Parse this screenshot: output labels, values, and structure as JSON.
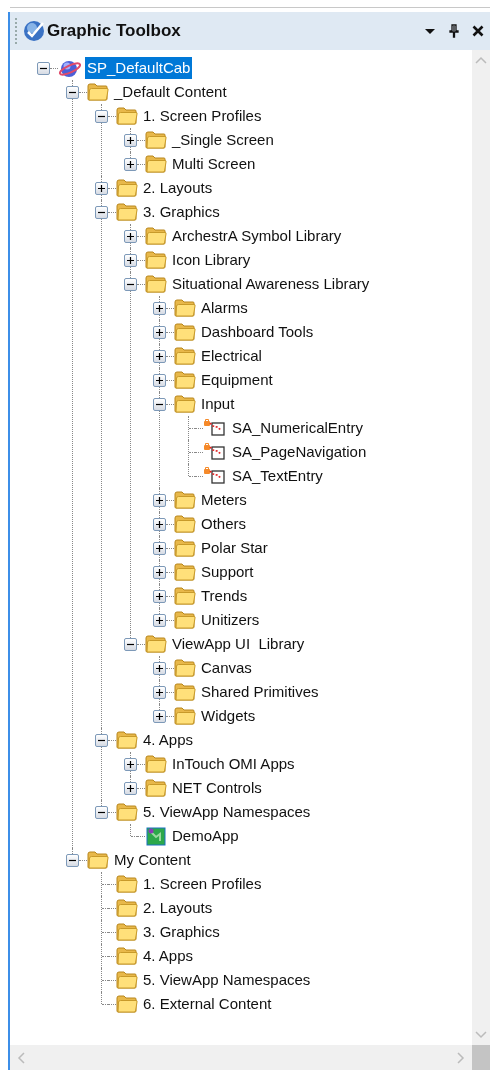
{
  "window": {
    "title": "Graphic Toolbox"
  },
  "tree": [
    {
      "label": "SP_DefaultCab",
      "kind": "root",
      "expanded": true,
      "selected": true,
      "children": [
        {
          "label": "_Default Content",
          "kind": "folder",
          "expanded": true,
          "selected": false,
          "children": [
            {
              "label": "1. Screen Profiles",
              "kind": "folder",
              "expanded": true,
              "selected": false,
              "children": [
                {
                  "label": "_Single Screen",
                  "kind": "folder",
                  "expanded": false,
                  "selected": false
                },
                {
                  "label": "Multi Screen",
                  "kind": "folder",
                  "expanded": false,
                  "selected": false
                }
              ]
            },
            {
              "label": "2. Layouts",
              "kind": "folder",
              "expanded": false,
              "selected": false
            },
            {
              "label": "3. Graphics",
              "kind": "folder",
              "expanded": true,
              "selected": false,
              "children": [
                {
                  "label": "ArchestrA Symbol Library",
                  "kind": "folder",
                  "expanded": false,
                  "selected": false
                },
                {
                  "label": "Icon Library",
                  "kind": "folder",
                  "expanded": false,
                  "selected": false
                },
                {
                  "label": "Situational Awareness Library",
                  "kind": "folder",
                  "expanded": true,
                  "selected": false,
                  "children": [
                    {
                      "label": "Alarms",
                      "kind": "folder",
                      "expanded": false,
                      "selected": false
                    },
                    {
                      "label": "Dashboard Tools",
                      "kind": "folder",
                      "expanded": false,
                      "selected": false
                    },
                    {
                      "label": "Electrical",
                      "kind": "folder",
                      "expanded": false,
                      "selected": false
                    },
                    {
                      "label": "Equipment",
                      "kind": "folder",
                      "expanded": false,
                      "selected": false
                    },
                    {
                      "label": "Input",
                      "kind": "folder",
                      "expanded": true,
                      "selected": false,
                      "children": [
                        {
                          "label": "SA_NumericalEntry",
                          "kind": "symbol",
                          "selected": false
                        },
                        {
                          "label": "SA_PageNavigation",
                          "kind": "symbol",
                          "selected": false
                        },
                        {
                          "label": "SA_TextEntry",
                          "kind": "symbol",
                          "selected": false
                        }
                      ]
                    },
                    {
                      "label": "Meters",
                      "kind": "folder",
                      "expanded": false,
                      "selected": false
                    },
                    {
                      "label": "Others",
                      "kind": "folder",
                      "expanded": false,
                      "selected": false
                    },
                    {
                      "label": "Polar Star",
                      "kind": "folder",
                      "expanded": false,
                      "selected": false
                    },
                    {
                      "label": "Support",
                      "kind": "folder",
                      "expanded": false,
                      "selected": false
                    },
                    {
                      "label": "Trends",
                      "kind": "folder",
                      "expanded": false,
                      "selected": false
                    },
                    {
                      "label": "Unitizers",
                      "kind": "folder",
                      "expanded": false,
                      "selected": false
                    }
                  ]
                },
                {
                  "label": "ViewApp UI  Library",
                  "kind": "folder",
                  "expanded": true,
                  "selected": false,
                  "children": [
                    {
                      "label": "Canvas",
                      "kind": "folder",
                      "expanded": false,
                      "selected": false
                    },
                    {
                      "label": "Shared Primitives",
                      "kind": "folder",
                      "expanded": false,
                      "selected": false
                    },
                    {
                      "label": "Widgets",
                      "kind": "folder",
                      "expanded": false,
                      "selected": false
                    }
                  ]
                }
              ]
            },
            {
              "label": "4. Apps",
              "kind": "folder",
              "expanded": true,
              "selected": false,
              "children": [
                {
                  "label": "InTouch OMI Apps",
                  "kind": "folder",
                  "expanded": false,
                  "selected": false
                },
                {
                  "label": "NET Controls",
                  "kind": "folder",
                  "expanded": false,
                  "selected": false
                }
              ]
            },
            {
              "label": "5. ViewApp Namespaces",
              "kind": "folder",
              "expanded": true,
              "selected": false,
              "children": [
                {
                  "label": "DemoApp",
                  "kind": "app",
                  "selected": false
                }
              ]
            }
          ]
        },
        {
          "label": "My Content",
          "kind": "folder",
          "expanded": true,
          "selected": false,
          "children": [
            {
              "label": "1. Screen Profiles",
              "kind": "folder",
              "selected": false
            },
            {
              "label": "2. Layouts",
              "kind": "folder",
              "selected": false
            },
            {
              "label": "3. Graphics",
              "kind": "folder",
              "selected": false
            },
            {
              "label": "4. Apps",
              "kind": "folder",
              "selected": false
            },
            {
              "label": "5. ViewApp Namespaces",
              "kind": "folder",
              "selected": false
            },
            {
              "label": "6. External Content",
              "kind": "folder",
              "selected": false
            }
          ]
        }
      ]
    }
  ]
}
